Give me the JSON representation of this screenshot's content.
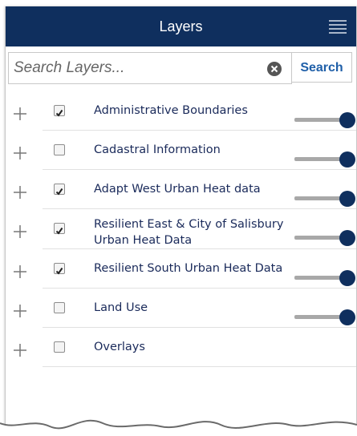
{
  "header": {
    "title": "Layers",
    "menu_icon": "hamburger-menu-icon"
  },
  "search": {
    "placeholder": "Search Layers...",
    "button_label": "Search",
    "clear_icon": "clear-circle-x-icon"
  },
  "colors": {
    "header_bg": "#0f2f5e",
    "accent": "#1f5fa8",
    "slider_track": "#a8a8a8",
    "slider_thumb": "#0f2f5e"
  },
  "layers": [
    {
      "label": "Administrative Boundaries",
      "checked": true,
      "has_slider": true
    },
    {
      "label": "Cadastral Information",
      "checked": false,
      "has_slider": true
    },
    {
      "label": "Adapt West Urban Heat data",
      "checked": true,
      "has_slider": true
    },
    {
      "label": "Resilient East & City of Salisbury Urban Heat Data",
      "checked": true,
      "has_slider": true
    },
    {
      "label": "Resilient South Urban Heat Data",
      "checked": true,
      "has_slider": true
    },
    {
      "label": "Land Use",
      "checked": false,
      "has_slider": true
    },
    {
      "label": "Overlays",
      "checked": false,
      "has_slider": false
    }
  ]
}
